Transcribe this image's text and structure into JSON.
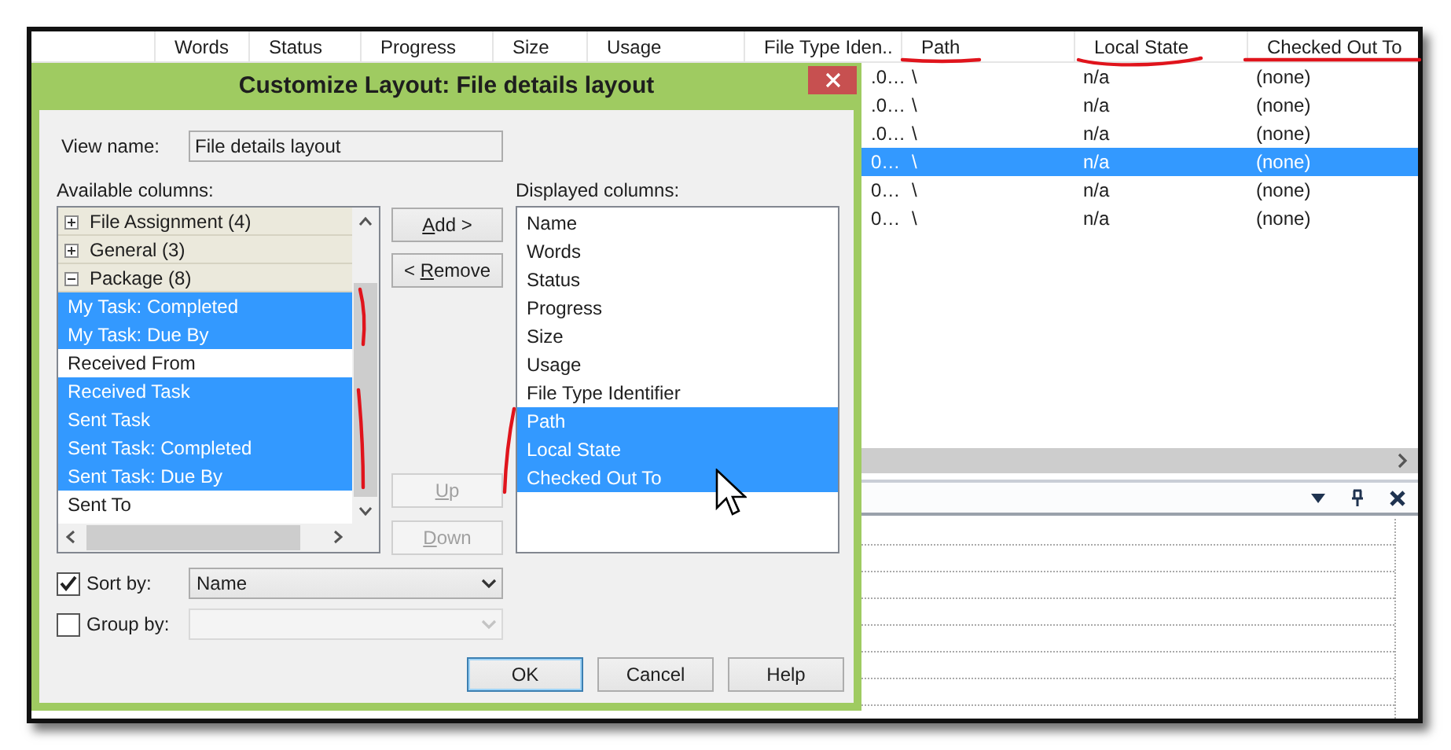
{
  "app": {
    "columns": [
      "Words",
      "Status",
      "Progress",
      "Size",
      "Usage",
      "File Type Iden..",
      "Path",
      "Local State",
      "Checked Out To"
    ],
    "rows": [
      {
        "file_type": ".0…",
        "path": "\\",
        "local_state": "n/a",
        "checked_out_to": "(none)",
        "selected": false
      },
      {
        "file_type": ".0…",
        "path": "\\",
        "local_state": "n/a",
        "checked_out_to": "(none)",
        "selected": false
      },
      {
        "file_type": ".0…",
        "path": "\\",
        "local_state": "n/a",
        "checked_out_to": "(none)",
        "selected": false
      },
      {
        "file_type": "0…",
        "path": "\\",
        "local_state": "n/a",
        "checked_out_to": "(none)",
        "selected": true
      },
      {
        "file_type": "0…",
        "path": "\\",
        "local_state": "n/a",
        "checked_out_to": "(none)",
        "selected": false
      },
      {
        "file_type": "0…",
        "path": "\\",
        "local_state": "n/a",
        "checked_out_to": "(none)",
        "selected": false
      }
    ]
  },
  "dialog": {
    "title": "Customize Layout: File details layout",
    "view_name": {
      "label": "View name:",
      "value": "File details layout"
    },
    "available": {
      "label": "Available columns:",
      "items": [
        {
          "kind": "group",
          "text": "File Assignment (4)",
          "expanded": false,
          "selected": false
        },
        {
          "kind": "group",
          "text": "General (3)",
          "expanded": false,
          "selected": false
        },
        {
          "kind": "group",
          "text": "Package (8)",
          "expanded": true,
          "selected": false
        },
        {
          "kind": "item",
          "text": "My Task: Completed",
          "selected": true
        },
        {
          "kind": "item",
          "text": "My Task: Due By",
          "selected": true
        },
        {
          "kind": "item",
          "text": "Received From",
          "selected": false
        },
        {
          "kind": "item",
          "text": "Received Task",
          "selected": true
        },
        {
          "kind": "item",
          "text": "Sent Task",
          "selected": true
        },
        {
          "kind": "item",
          "text": "Sent Task: Completed",
          "selected": true
        },
        {
          "kind": "item",
          "text": "Sent Task: Due By",
          "selected": true
        },
        {
          "kind": "item",
          "text": "Sent To",
          "selected": false
        }
      ]
    },
    "transfer_buttons": [
      {
        "key": "A",
        "post": "dd >",
        "disabled": false
      },
      {
        "pre": "< ",
        "key": "R",
        "post": "emove",
        "disabled": false
      }
    ],
    "move_buttons": [
      {
        "key": "U",
        "post": "p",
        "disabled": true
      },
      {
        "key": "D",
        "post": "own",
        "disabled": true
      }
    ],
    "displayed": {
      "label": "Displayed columns:",
      "items": [
        {
          "text": "Name",
          "selected": false
        },
        {
          "text": "Words",
          "selected": false
        },
        {
          "text": "Status",
          "selected": false
        },
        {
          "text": "Progress",
          "selected": false
        },
        {
          "text": "Size",
          "selected": false
        },
        {
          "text": "Usage",
          "selected": false
        },
        {
          "text": "File Type Identifier",
          "selected": false
        },
        {
          "text": "Path",
          "selected": true
        },
        {
          "text": "Local State",
          "selected": true
        },
        {
          "text": "Checked Out To",
          "selected": true
        }
      ]
    },
    "sort": {
      "label": "Sort by:",
      "checked": true,
      "value": "Name",
      "disabled": false
    },
    "group": {
      "label": "Group by:",
      "checked": false,
      "disabled": true
    },
    "footer": [
      {
        "label": "OK",
        "default": true
      },
      {
        "label": "Cancel",
        "default": false
      },
      {
        "label": "Help",
        "default": false
      }
    ]
  }
}
